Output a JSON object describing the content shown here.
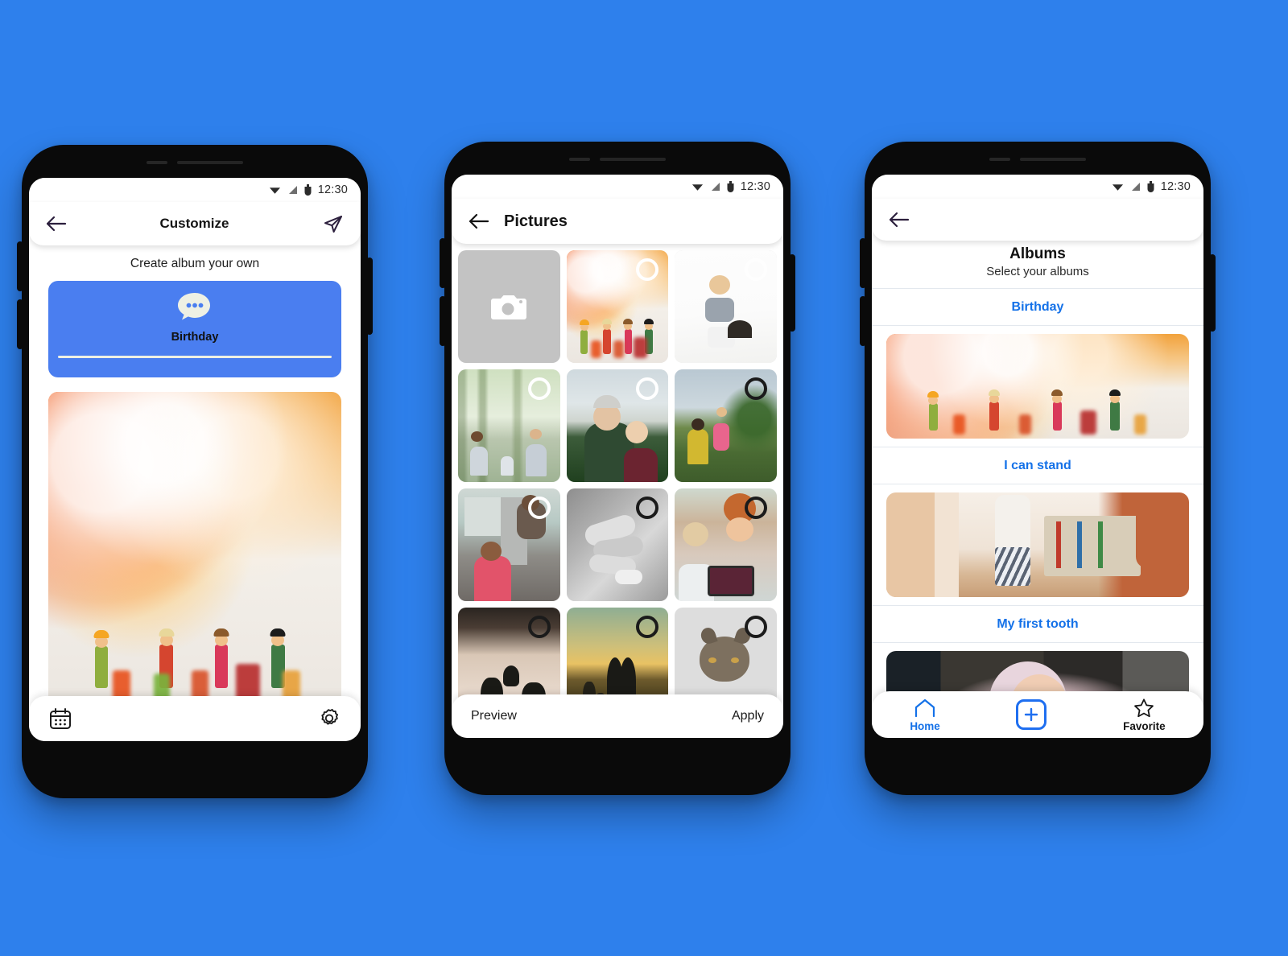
{
  "background_color": "#2e80ec",
  "status_bar": {
    "time": "12:30",
    "icons": [
      "wifi-icon",
      "signal-icon",
      "battery-icon"
    ]
  },
  "phone1": {
    "appbar": {
      "back": "back-arrow-icon",
      "title": "Customize",
      "action": "send-icon"
    },
    "subtitle": "Create album your own",
    "album_card": {
      "icon": "chat-bubble-icon",
      "label": "Birthday",
      "color": "#4a7ef0"
    },
    "hero_photo": "birthday-toys-photo",
    "bottom_bar": {
      "left_icon": "calendar-icon",
      "right_icon": "gear-icon"
    }
  },
  "phone2": {
    "appbar": {
      "back": "back-arrow-icon",
      "title": "Pictures"
    },
    "grid": [
      {
        "name": "camera-tile",
        "kind": "camera",
        "selected": false
      },
      {
        "name": "toys-photo",
        "kind": "photo",
        "selected": true,
        "ring": "light"
      },
      {
        "name": "baby-shoulders-photo",
        "kind": "photo",
        "selected": false,
        "ring": "dim"
      },
      {
        "name": "forest-family-photo",
        "kind": "photo",
        "selected": false,
        "ring": "light"
      },
      {
        "name": "elderly-couple-photo",
        "kind": "photo",
        "selected": false,
        "ring": "light"
      },
      {
        "name": "poppy-field-photo",
        "kind": "photo",
        "selected": true,
        "ring": "dark"
      },
      {
        "name": "kitchen-girl-photo",
        "kind": "photo",
        "selected": false,
        "ring": "light"
      },
      {
        "name": "hands-stack-photo",
        "kind": "photo",
        "selected": true,
        "ring": "dark"
      },
      {
        "name": "mother-tablet-photo",
        "kind": "photo",
        "selected": true,
        "ring": "dark"
      },
      {
        "name": "father-lifting-photo",
        "kind": "photo",
        "selected": true,
        "ring": "dark"
      },
      {
        "name": "sunset-couple-photo",
        "kind": "photo",
        "selected": true,
        "ring": "dark"
      },
      {
        "name": "cat-photo",
        "kind": "photo",
        "selected": true,
        "ring": "dark"
      }
    ],
    "bottom_bar": {
      "left_label": "Preview",
      "right_label": "Apply"
    }
  },
  "phone3": {
    "appbar": {
      "back": "back-arrow-icon"
    },
    "title": "Albums",
    "subtitle": "Select your albums",
    "albums": [
      {
        "label": "Birthday",
        "photo": "birthday-toys-photo"
      },
      {
        "label": "I can stand",
        "photo": "nursery-books-photo"
      },
      {
        "label": "My first tooth",
        "photo": "baby-towel-photo"
      }
    ],
    "nav": [
      {
        "label": "Home",
        "icon": "home-icon",
        "active": true
      },
      {
        "label": "",
        "icon": "plus-icon",
        "active": false
      },
      {
        "label": "Favorite",
        "icon": "star-icon",
        "active": false
      }
    ],
    "accent_color": "#1471e8"
  }
}
